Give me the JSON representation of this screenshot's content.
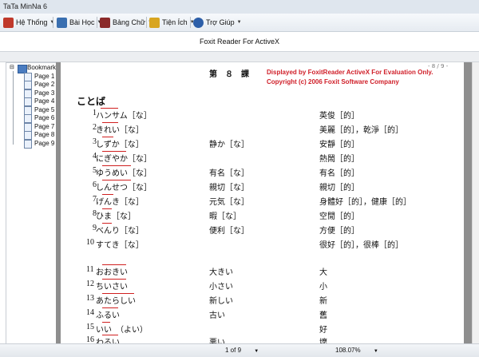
{
  "window": {
    "title": "TaTa MinNa 6"
  },
  "menu": [
    {
      "label": "Hệ Thống",
      "icon": "home-icon",
      "color": "#c0392b"
    },
    {
      "label": "Bài Học",
      "icon": "lesson-icon",
      "color": "#3a6fb0"
    },
    {
      "label": "Bảng Chữ",
      "icon": "book-icon",
      "color": "#8b2a2a"
    },
    {
      "label": "Tiện Ích",
      "icon": "tools-icon",
      "color": "#d8a520"
    },
    {
      "label": "Trợ Giúp",
      "icon": "help-icon",
      "color": "#2c5ea8"
    }
  ],
  "foxit": {
    "title": "Foxit Reader For ActiveX"
  },
  "bookmarks": {
    "root": "Bookmarks",
    "items": [
      "Page 1",
      "Page 2",
      "Page 3",
      "Page 4",
      "Page 5",
      "Page 6",
      "Page 7",
      "Page 8",
      "Page 9"
    ]
  },
  "document": {
    "lesson_header": "第　８　課",
    "eval_line1": "Displayed by FoxitReader ActiveX For Evaluation Only.",
    "eval_line2": "Copyright (c) 2006 Foxit Software Company",
    "page_indicator": "- 8 / 9 -",
    "section": "ことば",
    "rows": [
      {
        "num": "1",
        "reading": "ハンサム［な］",
        "kanji": "",
        "meaning": "英俊［的］"
      },
      {
        "num": "2",
        "reading": "きれい［な］",
        "kanji": "",
        "meaning": "美麗［的］，乾淨［的］"
      },
      {
        "num": "3",
        "reading": "しずか［な］",
        "kanji": "静か［な］",
        "meaning": "安靜［的］"
      },
      {
        "num": "4",
        "reading": "にぎやか［な］",
        "kanji": "",
        "meaning": "熱鬧［的］"
      },
      {
        "num": "5",
        "reading": "ゆうめい［な］",
        "kanji": "有名［な］",
        "meaning": "有名［的］"
      },
      {
        "num": "6",
        "reading": "しんせつ［な］",
        "kanji": "親切［な］",
        "meaning": "親切［的］"
      },
      {
        "num": "7",
        "reading": "げんき［な］",
        "kanji": "元気［な］",
        "meaning": "身體好［的］，健康［的］"
      },
      {
        "num": "8",
        "reading": "ひま［な］",
        "kanji": "暇［な］",
        "meaning": "空閒［的］"
      },
      {
        "num": "9",
        "reading": "べんり［な］",
        "kanji": "便利［な］",
        "meaning": "方便［的］"
      },
      {
        "num": "10",
        "reading": "すてき［な］",
        "kanji": "",
        "meaning": "很好［的］，很棒［的］"
      },
      {
        "num": "11",
        "reading": "おおきい",
        "kanji": "大きい",
        "meaning": "大"
      },
      {
        "num": "12",
        "reading": "ちいさい",
        "kanji": "小さい",
        "meaning": "小"
      },
      {
        "num": "13",
        "reading": "あたらしい",
        "kanji": "新しい",
        "meaning": "新"
      },
      {
        "num": "14",
        "reading": "ふるい",
        "kanji": "古い",
        "meaning": "舊"
      },
      {
        "num": "15",
        "reading": "いい　（よい）",
        "kanji": "",
        "meaning": "好"
      },
      {
        "num": "16",
        "reading": "わるい",
        "kanji": "悪い",
        "meaning": "壞"
      }
    ]
  },
  "status": {
    "page": "1 of 9",
    "zoom": "108.07%"
  }
}
